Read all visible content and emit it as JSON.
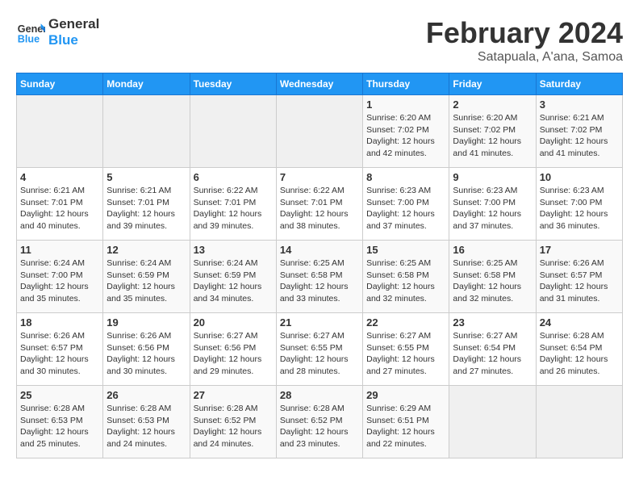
{
  "header": {
    "logo_line1": "General",
    "logo_line2": "Blue",
    "month_title": "February 2024",
    "location": "Satapuala, A'ana, Samoa"
  },
  "calendar": {
    "weekdays": [
      "Sunday",
      "Monday",
      "Tuesday",
      "Wednesday",
      "Thursday",
      "Friday",
      "Saturday"
    ],
    "weeks": [
      [
        {
          "day": "",
          "info": ""
        },
        {
          "day": "",
          "info": ""
        },
        {
          "day": "",
          "info": ""
        },
        {
          "day": "",
          "info": ""
        },
        {
          "day": "1",
          "info": "Sunrise: 6:20 AM\nSunset: 7:02 PM\nDaylight: 12 hours\nand 42 minutes."
        },
        {
          "day": "2",
          "info": "Sunrise: 6:20 AM\nSunset: 7:02 PM\nDaylight: 12 hours\nand 41 minutes."
        },
        {
          "day": "3",
          "info": "Sunrise: 6:21 AM\nSunset: 7:02 PM\nDaylight: 12 hours\nand 41 minutes."
        }
      ],
      [
        {
          "day": "4",
          "info": "Sunrise: 6:21 AM\nSunset: 7:01 PM\nDaylight: 12 hours\nand 40 minutes."
        },
        {
          "day": "5",
          "info": "Sunrise: 6:21 AM\nSunset: 7:01 PM\nDaylight: 12 hours\nand 39 minutes."
        },
        {
          "day": "6",
          "info": "Sunrise: 6:22 AM\nSunset: 7:01 PM\nDaylight: 12 hours\nand 39 minutes."
        },
        {
          "day": "7",
          "info": "Sunrise: 6:22 AM\nSunset: 7:01 PM\nDaylight: 12 hours\nand 38 minutes."
        },
        {
          "day": "8",
          "info": "Sunrise: 6:23 AM\nSunset: 7:00 PM\nDaylight: 12 hours\nand 37 minutes."
        },
        {
          "day": "9",
          "info": "Sunrise: 6:23 AM\nSunset: 7:00 PM\nDaylight: 12 hours\nand 37 minutes."
        },
        {
          "day": "10",
          "info": "Sunrise: 6:23 AM\nSunset: 7:00 PM\nDaylight: 12 hours\nand 36 minutes."
        }
      ],
      [
        {
          "day": "11",
          "info": "Sunrise: 6:24 AM\nSunset: 7:00 PM\nDaylight: 12 hours\nand 35 minutes."
        },
        {
          "day": "12",
          "info": "Sunrise: 6:24 AM\nSunset: 6:59 PM\nDaylight: 12 hours\nand 35 minutes."
        },
        {
          "day": "13",
          "info": "Sunrise: 6:24 AM\nSunset: 6:59 PM\nDaylight: 12 hours\nand 34 minutes."
        },
        {
          "day": "14",
          "info": "Sunrise: 6:25 AM\nSunset: 6:58 PM\nDaylight: 12 hours\nand 33 minutes."
        },
        {
          "day": "15",
          "info": "Sunrise: 6:25 AM\nSunset: 6:58 PM\nDaylight: 12 hours\nand 32 minutes."
        },
        {
          "day": "16",
          "info": "Sunrise: 6:25 AM\nSunset: 6:58 PM\nDaylight: 12 hours\nand 32 minutes."
        },
        {
          "day": "17",
          "info": "Sunrise: 6:26 AM\nSunset: 6:57 PM\nDaylight: 12 hours\nand 31 minutes."
        }
      ],
      [
        {
          "day": "18",
          "info": "Sunrise: 6:26 AM\nSunset: 6:57 PM\nDaylight: 12 hours\nand 30 minutes."
        },
        {
          "day": "19",
          "info": "Sunrise: 6:26 AM\nSunset: 6:56 PM\nDaylight: 12 hours\nand 30 minutes."
        },
        {
          "day": "20",
          "info": "Sunrise: 6:27 AM\nSunset: 6:56 PM\nDaylight: 12 hours\nand 29 minutes."
        },
        {
          "day": "21",
          "info": "Sunrise: 6:27 AM\nSunset: 6:55 PM\nDaylight: 12 hours\nand 28 minutes."
        },
        {
          "day": "22",
          "info": "Sunrise: 6:27 AM\nSunset: 6:55 PM\nDaylight: 12 hours\nand 27 minutes."
        },
        {
          "day": "23",
          "info": "Sunrise: 6:27 AM\nSunset: 6:54 PM\nDaylight: 12 hours\nand 27 minutes."
        },
        {
          "day": "24",
          "info": "Sunrise: 6:28 AM\nSunset: 6:54 PM\nDaylight: 12 hours\nand 26 minutes."
        }
      ],
      [
        {
          "day": "25",
          "info": "Sunrise: 6:28 AM\nSunset: 6:53 PM\nDaylight: 12 hours\nand 25 minutes."
        },
        {
          "day": "26",
          "info": "Sunrise: 6:28 AM\nSunset: 6:53 PM\nDaylight: 12 hours\nand 24 minutes."
        },
        {
          "day": "27",
          "info": "Sunrise: 6:28 AM\nSunset: 6:52 PM\nDaylight: 12 hours\nand 24 minutes."
        },
        {
          "day": "28",
          "info": "Sunrise: 6:28 AM\nSunset: 6:52 PM\nDaylight: 12 hours\nand 23 minutes."
        },
        {
          "day": "29",
          "info": "Sunrise: 6:29 AM\nSunset: 6:51 PM\nDaylight: 12 hours\nand 22 minutes."
        },
        {
          "day": "",
          "info": ""
        },
        {
          "day": "",
          "info": ""
        }
      ]
    ]
  }
}
